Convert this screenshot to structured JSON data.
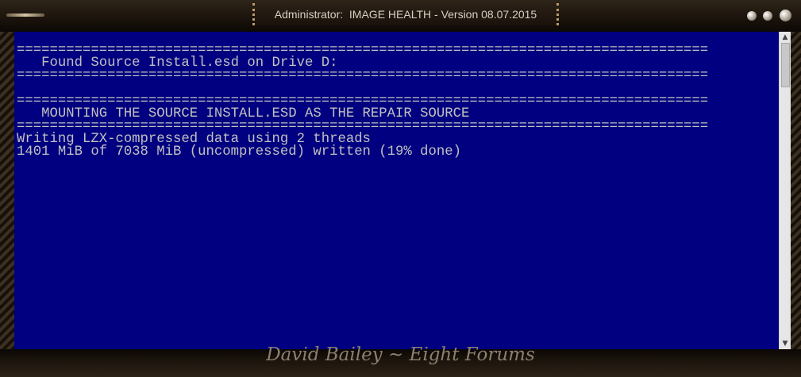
{
  "window": {
    "title": "Administrator:  IMAGE HEALTH - Version 08.07.2015"
  },
  "console": {
    "lines": [
      "====================================================================================",
      "   Found Source Install.esd on Drive D:",
      "====================================================================================",
      "",
      "====================================================================================",
      "   MOUNTING THE SOURCE INSTALL.ESD AS THE REPAIR SOURCE",
      "====================================================================================",
      "Writing LZX-compressed data using 2 threads",
      "1401 MiB of 7038 MiB (uncompressed) written (19% done)"
    ],
    "background_color": "#000080",
    "text_color": "#c0c0c0"
  },
  "scrollbar": {
    "up_icon": "▲",
    "down_icon": "▼"
  },
  "frame": {
    "signature": "David Bailey ~ Eight Forums"
  }
}
